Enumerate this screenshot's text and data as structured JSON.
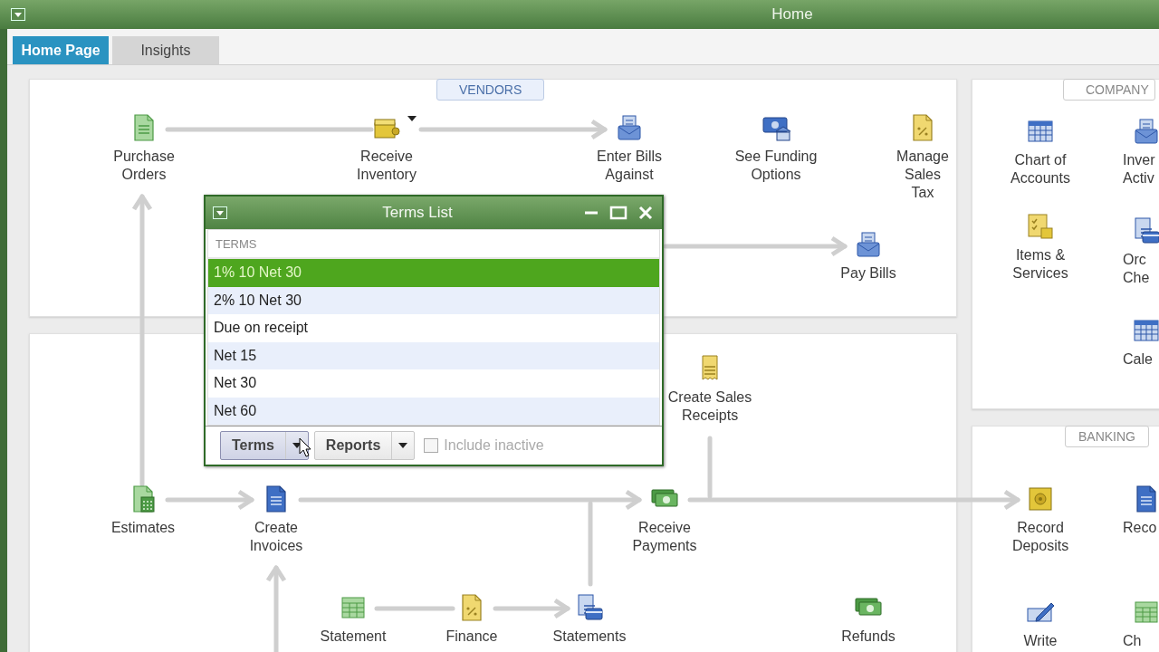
{
  "window": {
    "title": "Home"
  },
  "tabs": [
    {
      "label": "Home Page",
      "selected": true
    },
    {
      "label": "Insights",
      "selected": false
    }
  ],
  "vendors": {
    "title": "VENDORS",
    "nodes": [
      {
        "label": "Purchase\nOrders"
      },
      {
        "label": "Receive\nInventory"
      },
      {
        "label": "Enter Bills\nAgainst"
      },
      {
        "label": "See Funding\nOptions"
      },
      {
        "label": "Manage\nSales\nTax"
      },
      {
        "label": "Pay Bills"
      }
    ]
  },
  "customers": {
    "nodes": [
      {
        "label": "Create Sales\nReceipts"
      },
      {
        "label": "Estimates"
      },
      {
        "label": "Create\nInvoices"
      },
      {
        "label": "Receive\nPayments"
      },
      {
        "label": "Statement"
      },
      {
        "label": "Finance"
      },
      {
        "label": "Statements"
      },
      {
        "label": "Refunds"
      }
    ]
  },
  "company": {
    "title": "COMPANY",
    "nodes": [
      {
        "label": "Chart of\nAccounts"
      },
      {
        "label": "Inver\nActiv"
      },
      {
        "label": "Items &\nServices"
      },
      {
        "label": "Orc\nChe"
      },
      {
        "label": "Cale"
      }
    ]
  },
  "banking": {
    "title": "BANKING",
    "nodes": [
      {
        "label": "Record\nDeposits"
      },
      {
        "label": "Reco"
      },
      {
        "label": "Write"
      },
      {
        "label": "Ch"
      }
    ]
  },
  "terms_list": {
    "title": "Terms List",
    "column": "TERMS",
    "rows": [
      {
        "label": "1% 10 Net 30",
        "selected": true
      },
      {
        "label": "2% 10 Net 30",
        "selected": false
      },
      {
        "label": "Due on receipt",
        "selected": false
      },
      {
        "label": "Net 15",
        "selected": false
      },
      {
        "label": "Net 30",
        "selected": false
      },
      {
        "label": "Net 60",
        "selected": false
      }
    ],
    "buttons": [
      {
        "label": "Terms",
        "hovered": true
      },
      {
        "label": "Reports",
        "hovered": false
      }
    ],
    "include_inactive": {
      "label": "Include inactive",
      "checked": false,
      "disabled": true
    }
  }
}
